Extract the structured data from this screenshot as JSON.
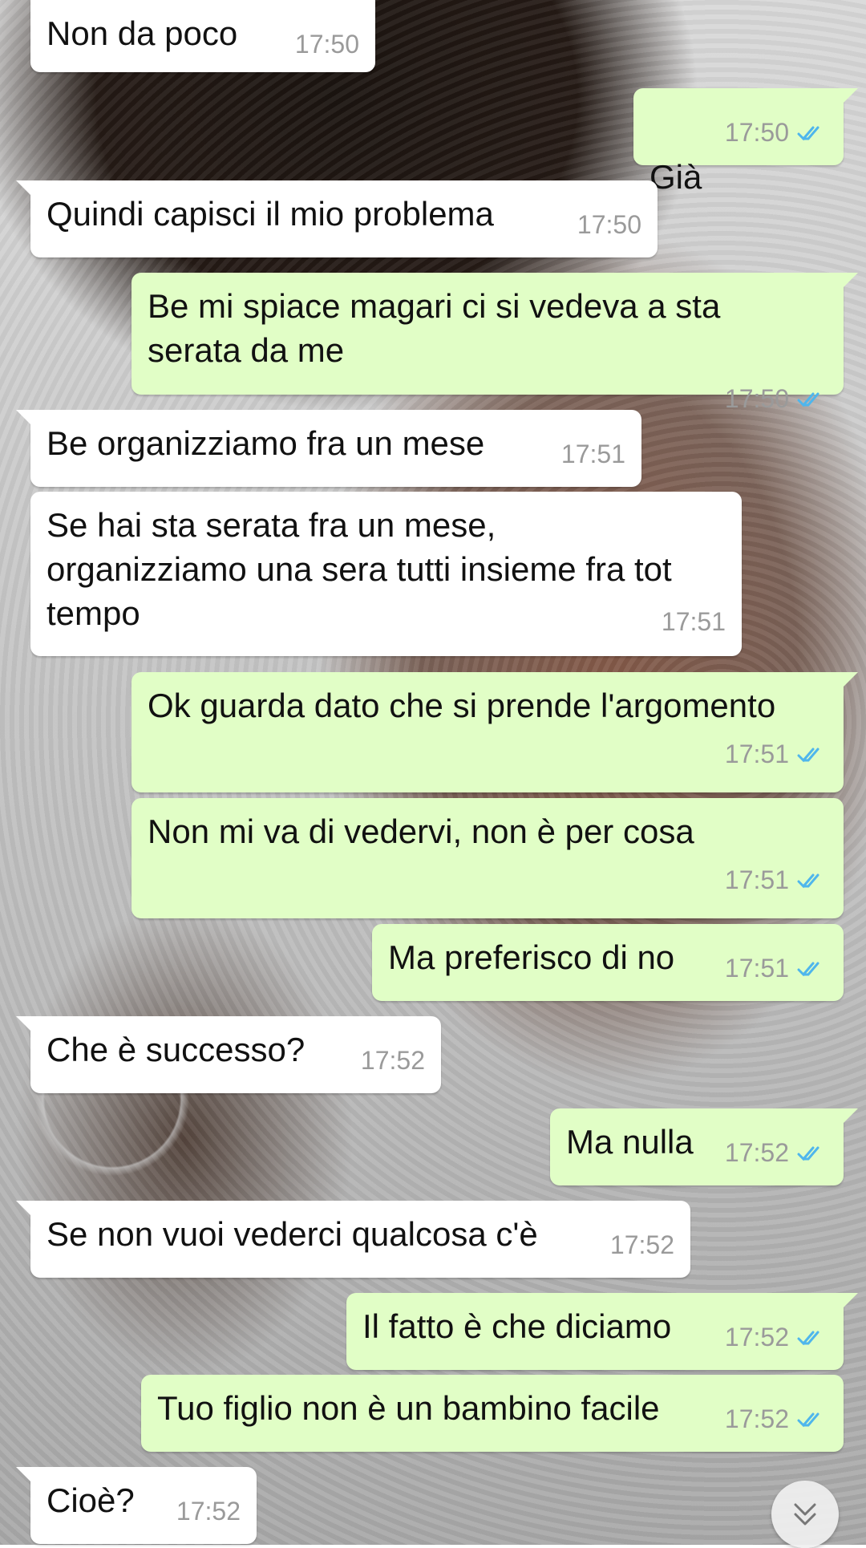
{
  "messages": [
    {
      "dir": "in",
      "text": "Non da poco",
      "time": "17:50"
    },
    {
      "dir": "out",
      "text": "Già",
      "time": "17:50",
      "read": true
    },
    {
      "dir": "in",
      "text": "Quindi capisci il mio problema",
      "time": "17:50"
    },
    {
      "dir": "out",
      "text": "Be mi spiace magari ci si vedeva a sta serata da me",
      "time": "17:50",
      "read": true
    },
    {
      "dir": "in",
      "text": "Be organizziamo fra un mese",
      "time": "17:51"
    },
    {
      "dir": "in",
      "text": "Se hai sta serata fra un mese, organizziamo una sera tutti insieme fra tot tempo",
      "time": "17:51"
    },
    {
      "dir": "out",
      "text": "Ok guarda dato che si prende l'argomento",
      "time": "17:51",
      "read": true
    },
    {
      "dir": "out",
      "text": "Non mi va di vedervi, non è per cosa",
      "time": "17:51",
      "read": true
    },
    {
      "dir": "out",
      "text": "Ma preferisco di no",
      "time": "17:51",
      "read": true
    },
    {
      "dir": "in",
      "text": "Che è successo?",
      "time": "17:52"
    },
    {
      "dir": "out",
      "text": "Ma nulla",
      "time": "17:52",
      "read": true
    },
    {
      "dir": "in",
      "text": "Se non vuoi vederci qualcosa c'è",
      "time": "17:52"
    },
    {
      "dir": "out",
      "text": "Il fatto è che diciamo",
      "time": "17:52",
      "read": true
    },
    {
      "dir": "out",
      "text": "Tuo figlio non è un bambino facile",
      "time": "17:52",
      "read": true
    },
    {
      "dir": "in",
      "text": "Cioè?",
      "time": "17:52"
    }
  ],
  "colors": {
    "incoming_bubble": "#ffffff",
    "outgoing_bubble": "#e1fec6",
    "read_ticks": "#4fb6ec",
    "timestamp": "#9a9a9a"
  },
  "icons": {
    "read_receipt": "double-check-icon",
    "scroll_down": "chevron-double-down-icon"
  }
}
